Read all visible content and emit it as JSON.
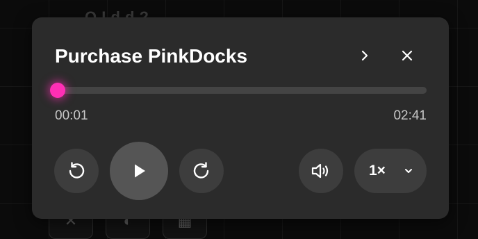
{
  "background": {
    "partial_heading": "Q I d d ?",
    "icons": [
      "x-logo-icon",
      "globe-icon",
      "table-icon"
    ]
  },
  "player": {
    "title": "Purchase PinkDocks",
    "progress": {
      "current_time": "00:01",
      "total_time": "02:41",
      "fraction": 0.007
    },
    "speed": {
      "label": "1×"
    },
    "accent_color": "#ff2fb5",
    "icons": {
      "next": "chevron-right-icon",
      "close": "close-icon",
      "rewind": "rewind-icon",
      "play": "play-icon",
      "forward": "forward-icon",
      "volume": "volume-icon",
      "speed_menu": "chevron-down-icon"
    }
  }
}
